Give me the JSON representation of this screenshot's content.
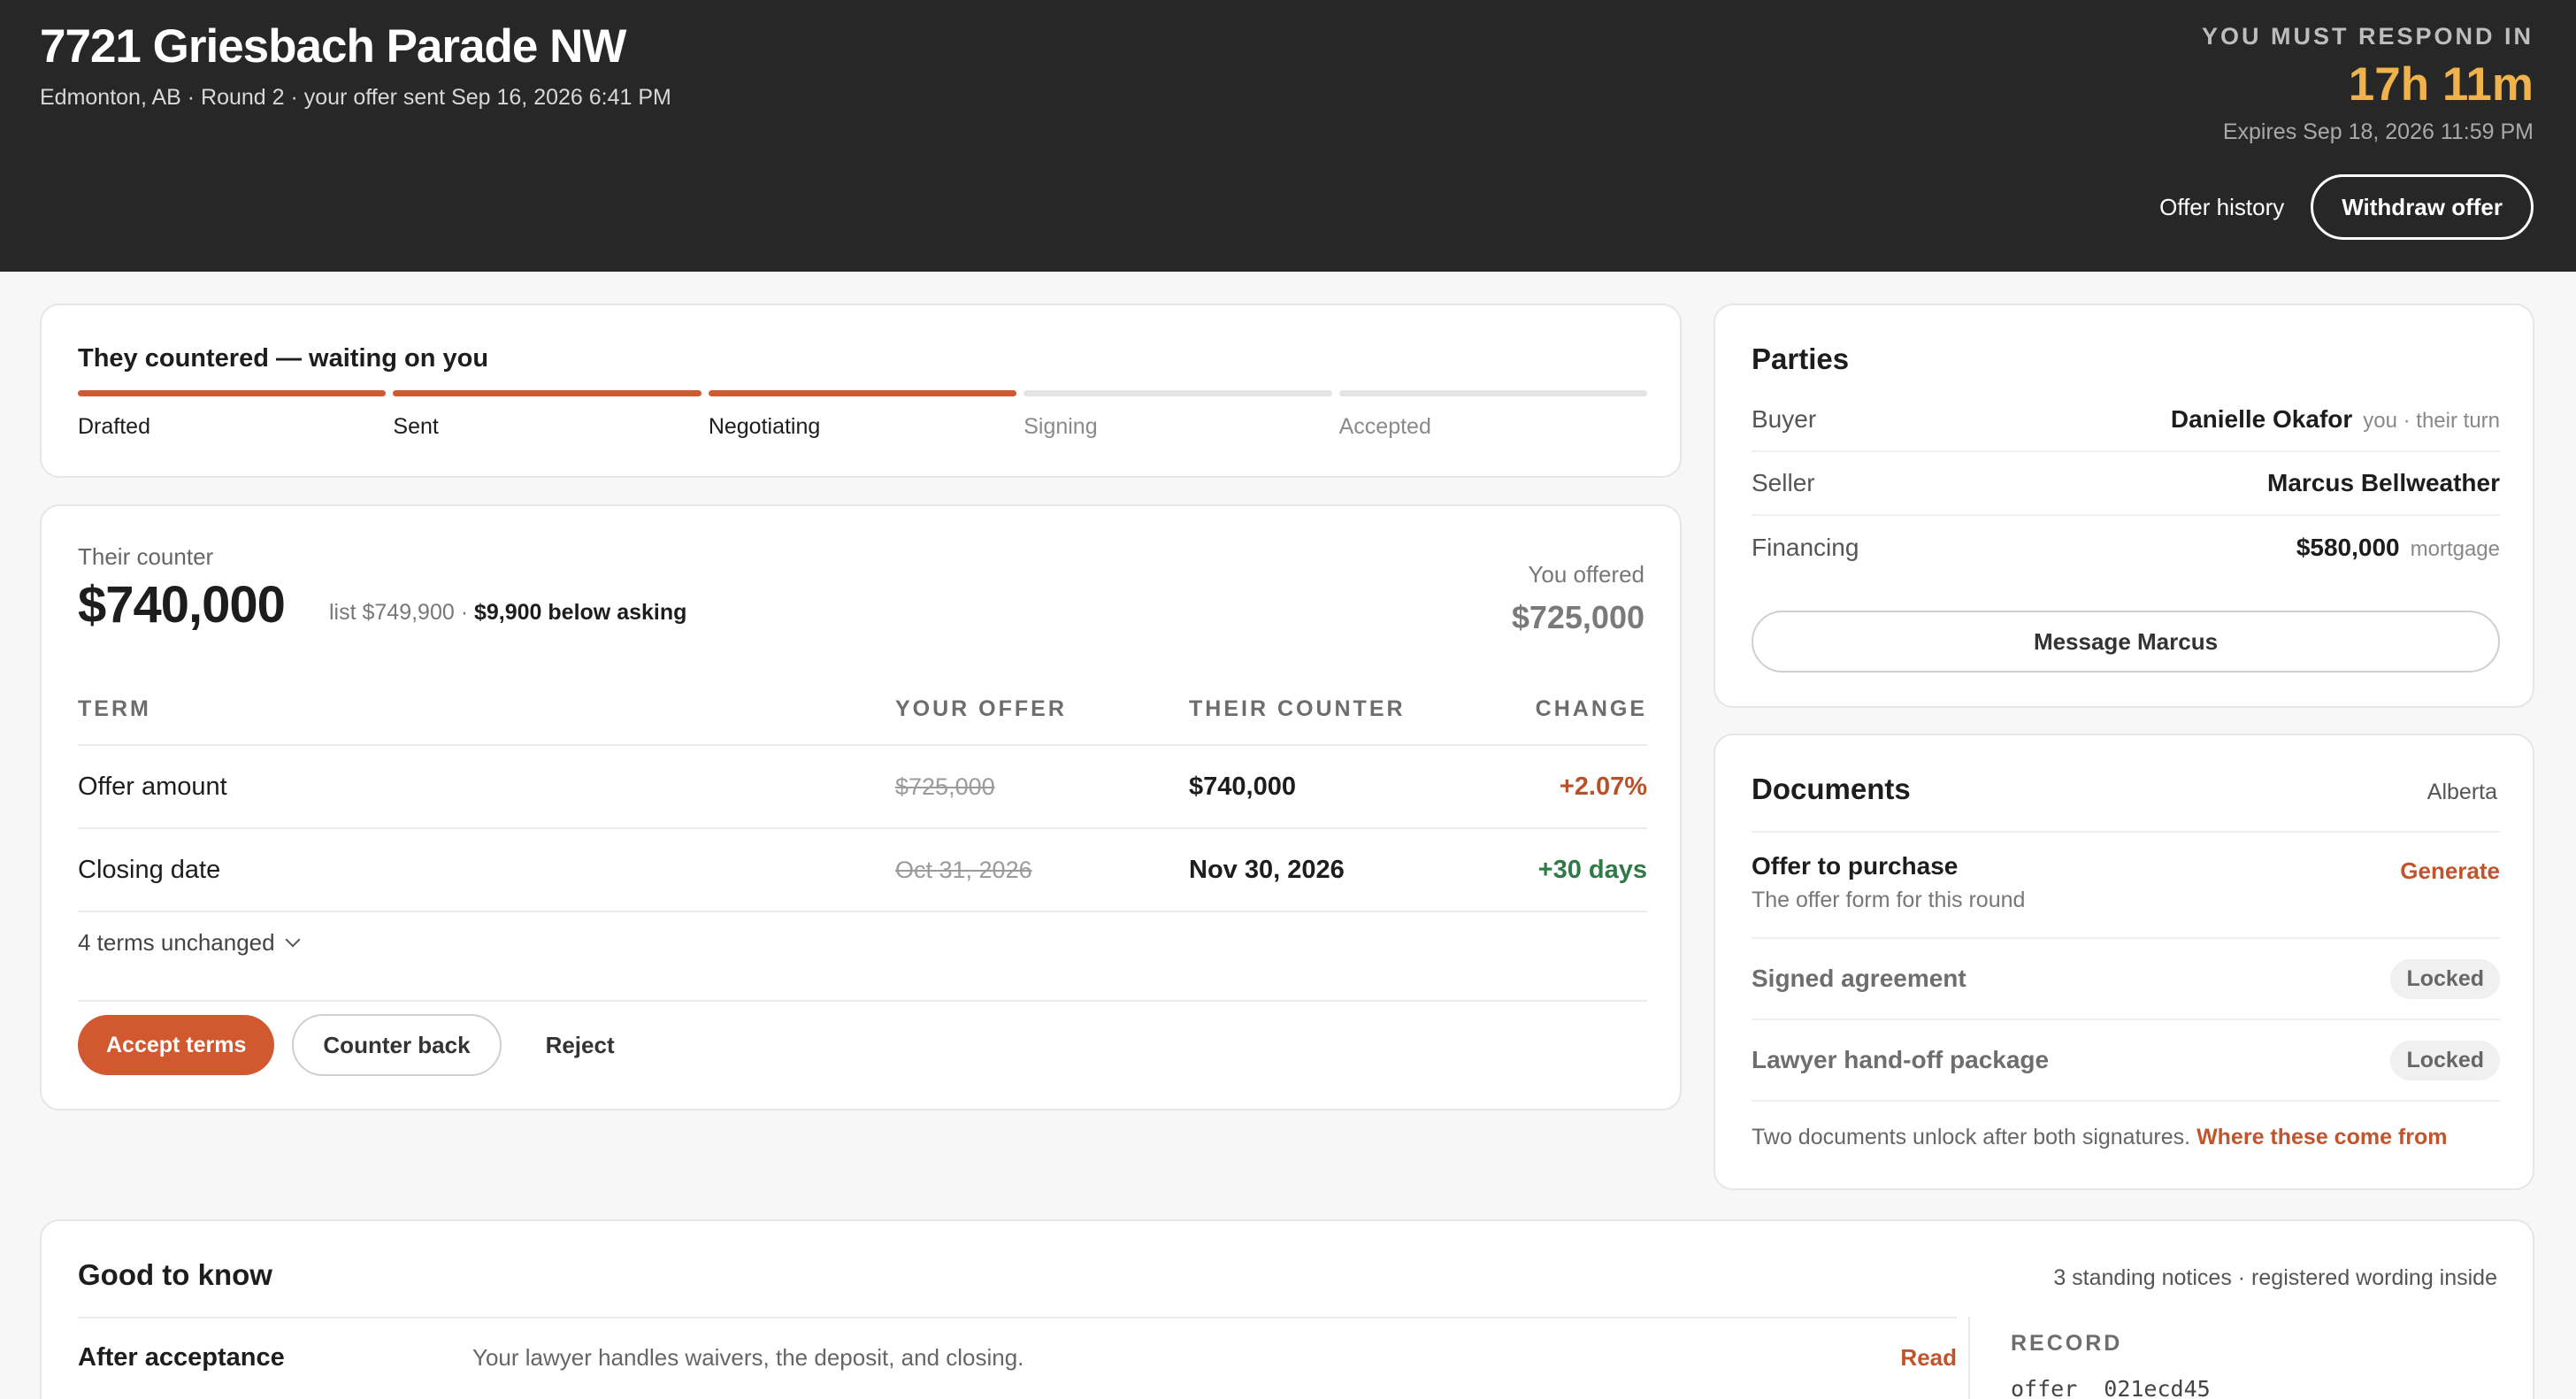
{
  "header": {
    "title": "7721 Griesbach Parade NW",
    "subtitle": "Edmonton, AB · Round 2 · your offer sent Sep 16, 2026 6:41 PM",
    "respond_label": "YOU MUST RESPOND IN",
    "countdown": "17h 11m",
    "expires": "Expires Sep 18, 2026 11:59 PM",
    "offer_history": "Offer history",
    "withdraw": "Withdraw offer"
  },
  "progress": {
    "title": "They countered — waiting on you",
    "steps": [
      {
        "label": "Drafted",
        "state": "done"
      },
      {
        "label": "Sent",
        "state": "done"
      },
      {
        "label": "Negotiating",
        "state": "done"
      },
      {
        "label": "Signing",
        "state": "todo"
      },
      {
        "label": "Accepted",
        "state": "todo"
      }
    ]
  },
  "counter": {
    "label": "Their counter",
    "price": "$740,000",
    "list_note": "list $749,900 · ",
    "below_note": "$9,900 below asking",
    "you_offered_label": "You offered",
    "you_offered_value": "$725,000",
    "columns": [
      "TERM",
      "YOUR OFFER",
      "THEIR COUNTER",
      "CHANGE"
    ],
    "rows": [
      {
        "term": "Offer amount",
        "yours": "$725,000",
        "theirs": "$740,000",
        "change": "+2.07%"
      },
      {
        "term": "Closing date",
        "yours": "Oct 31, 2026",
        "theirs": "Nov 30, 2026",
        "change": "+30 days"
      }
    ],
    "unchanged": "4 terms unchanged",
    "accept": "Accept terms",
    "counter_back": "Counter back",
    "reject": "Reject"
  },
  "parties": {
    "title": "Parties",
    "rows": [
      {
        "key": "Buyer",
        "value": "Danielle Okafor",
        "meta": "you · their turn"
      },
      {
        "key": "Seller",
        "value": "Marcus Bellweather",
        "meta": ""
      },
      {
        "key": "Financing",
        "value": "$580,000",
        "meta": "mortgage"
      }
    ],
    "message_button": "Message Marcus"
  },
  "documents": {
    "title": "Documents",
    "region": "Alberta",
    "offer_title": "Offer to purchase",
    "offer_sub": "The offer form for this round",
    "generate": "Generate",
    "signed": "Signed agreement",
    "lawyer": "Lawyer hand-off package",
    "locked": "Locked",
    "note": "Two documents unlock after both signatures. ",
    "note_link": "Where these come from"
  },
  "know": {
    "title": "Good to know",
    "meta": "3 standing notices · registered wording inside",
    "row_title": "After acceptance",
    "row_desc": "Your lawyer handles waivers, the deposit, and closing.",
    "row_link": "Read",
    "record_title": "RECORD",
    "record_key": "offer",
    "record_value": "021ecd45"
  },
  "colors": {
    "accent": "#d2582f",
    "header_bg": "#272727",
    "countdown": "#f0b24a",
    "positive": "#2f7a46"
  }
}
